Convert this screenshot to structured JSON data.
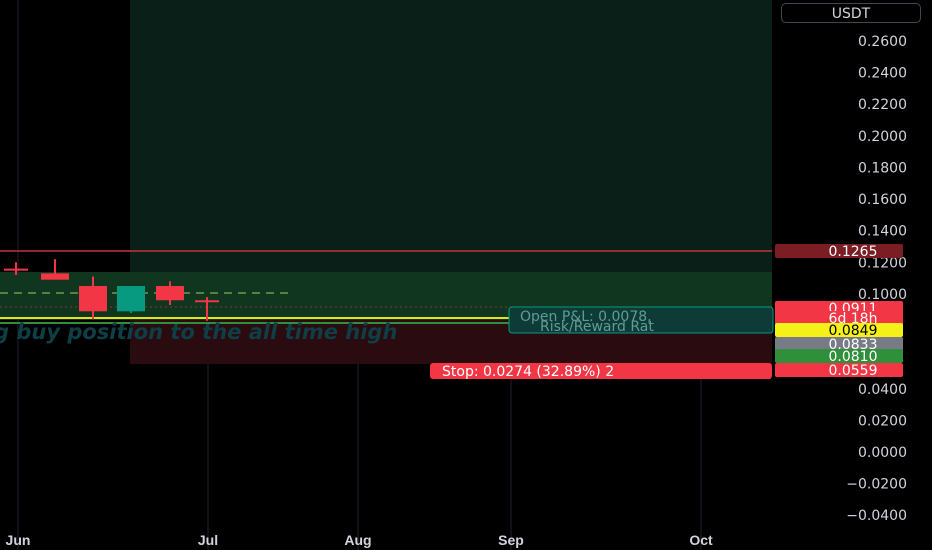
{
  "price_unit": "USDT",
  "chart_data": {
    "type": "candlestick",
    "y_ticks": [
      "0.2600",
      "0.2400",
      "0.2200",
      "0.2000",
      "0.1800",
      "0.1600",
      "0.1400",
      "0.1200",
      "0.1000",
      "0.0400",
      "0.0200",
      "0.0000",
      "−0.0200",
      "−0.0400"
    ],
    "x_ticks": [
      "Jun",
      "Jul",
      "Aug",
      "Sep",
      "Oct"
    ],
    "ylim": [
      -0.045,
      0.27
    ],
    "candles": [
      {
        "x": 0.5,
        "open": 0.116,
        "high": 0.12,
        "low": 0.112,
        "close": 0.116,
        "color": "#f23645"
      },
      {
        "x": 1.0,
        "open": 0.113,
        "high": 0.122,
        "low": 0.11,
        "close": 0.109,
        "color": "#f23645"
      },
      {
        "x": 2.0,
        "open": 0.105,
        "high": 0.111,
        "low": 0.084,
        "close": 0.089,
        "color": "#f23645"
      },
      {
        "x": 3.0,
        "open": 0.089,
        "high": 0.105,
        "low": 0.088,
        "close": 0.105,
        "color": "#089981"
      },
      {
        "x": 3.9,
        "open": 0.105,
        "high": 0.108,
        "low": 0.093,
        "close": 0.096,
        "color": "#f23645"
      },
      {
        "x": 4.9,
        "open": 0.096,
        "high": 0.098,
        "low": 0.083,
        "close": 0.095,
        "color": "#f23645"
      }
    ],
    "levels": {
      "resistance": 0.1265,
      "target_zone_top": 0.113,
      "entry": 0.0833,
      "stop": 0.0559,
      "dashed": 0.101
    },
    "price_tags": [
      {
        "label": "0.1265",
        "value": 0.1265,
        "bg": "#7a1e24",
        "fg": "#ffffff"
      },
      {
        "label": "0.0911",
        "value": 0.0911,
        "bg": "#f23645",
        "fg": "#ffffff"
      },
      {
        "label": "6d 18h",
        "value": 0.088,
        "bg": "#f23645",
        "fg": "#ffffff"
      },
      {
        "label": "0.0849",
        "value": 0.0849,
        "bg": "#f5f118",
        "fg": "#000000"
      },
      {
        "label": "0.0833",
        "value": 0.0821,
        "bg": "#787b86",
        "fg": "#ffffff"
      },
      {
        "label": "0.0810",
        "value": 0.0773,
        "bg": "#2f8f3a",
        "fg": "#ffffff"
      },
      {
        "label": "0.0559",
        "value": 0.0559,
        "bg": "#f23645",
        "fg": "#ffffff"
      }
    ],
    "annotations": {
      "pnl_line1": "Open P&L: 0.0078,",
      "pnl_line2": "Risk/Reward Rat",
      "stop_text": "Stop: 0.0274 (32.89%) 2",
      "idea_text": "g buy position to the all time high"
    }
  }
}
